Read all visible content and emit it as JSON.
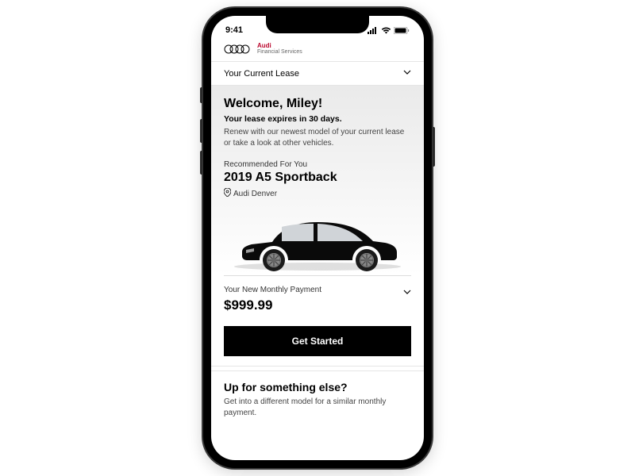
{
  "status_bar": {
    "time": "9:41"
  },
  "brand": {
    "name": "Audi",
    "service": "Financial Services"
  },
  "lease_dropdown": {
    "label": "Your Current Lease"
  },
  "welcome": {
    "title": "Welcome, Miley!",
    "expiry": "Your lease expires in 30 days.",
    "body": "Renew with our newest model of your current lease or take a look at other vehicles."
  },
  "recommendation": {
    "label": "Recommended For You",
    "model": "2019 A5 Sportback",
    "dealer": "Audi Denver"
  },
  "payment": {
    "label": "Your New Monthly Payment",
    "amount": "$999.99"
  },
  "cta": {
    "get_started": "Get Started"
  },
  "alternative": {
    "title": "Up for something else?",
    "body": "Get into a different model for a similar monthly payment."
  }
}
